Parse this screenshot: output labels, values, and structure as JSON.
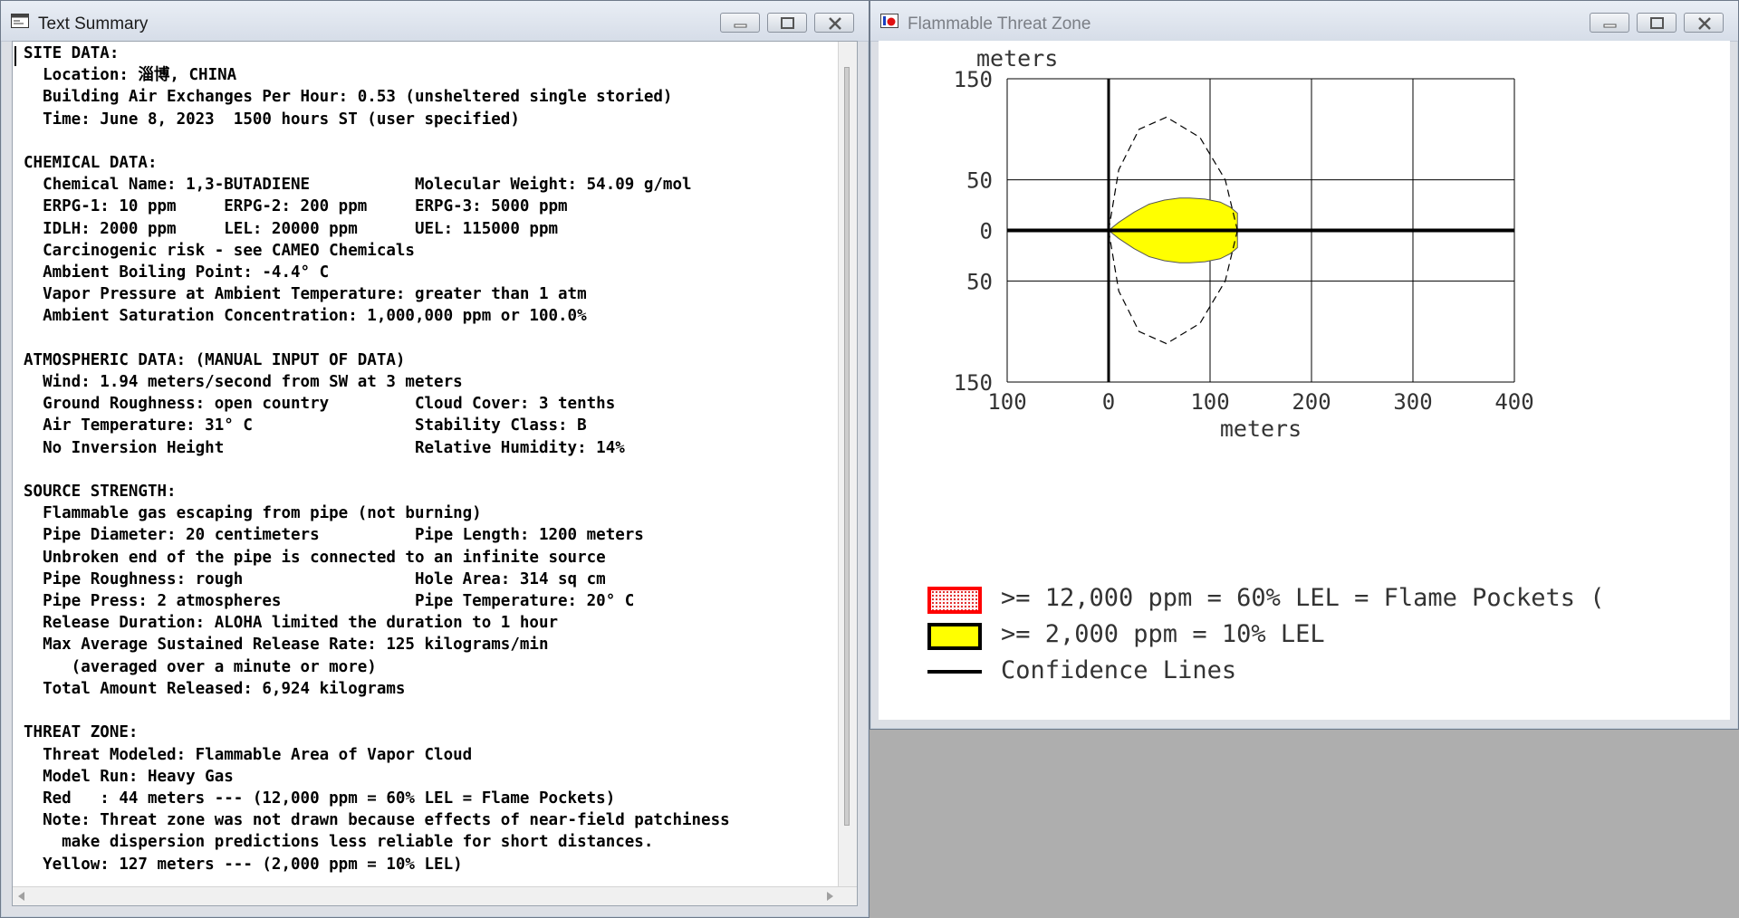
{
  "text_window": {
    "title": "Text Summary",
    "lines": [
      "SITE DATA:",
      "  Location: 淄博, CHINA",
      "  Building Air Exchanges Per Hour: 0.53 (unsheltered single storied)",
      "  Time: June 8, 2023  1500 hours ST (user specified)",
      "",
      "CHEMICAL DATA:",
      "  Chemical Name: 1,3-BUTADIENE           Molecular Weight: 54.09 g/mol",
      "  ERPG-1: 10 ppm     ERPG-2: 200 ppm     ERPG-3: 5000 ppm",
      "  IDLH: 2000 ppm     LEL: 20000 ppm      UEL: 115000 ppm",
      "  Carcinogenic risk - see CAMEO Chemicals",
      "  Ambient Boiling Point: -4.4° C",
      "  Vapor Pressure at Ambient Temperature: greater than 1 atm",
      "  Ambient Saturation Concentration: 1,000,000 ppm or 100.0%",
      "",
      "ATMOSPHERIC DATA: (MANUAL INPUT OF DATA)",
      "  Wind: 1.94 meters/second from SW at 3 meters",
      "  Ground Roughness: open country         Cloud Cover: 3 tenths",
      "  Air Temperature: 31° C                 Stability Class: B",
      "  No Inversion Height                    Relative Humidity: 14%",
      "",
      "SOURCE STRENGTH:",
      "  Flammable gas escaping from pipe (not burning)",
      "  Pipe Diameter: 20 centimeters          Pipe Length: 1200 meters",
      "  Unbroken end of the pipe is connected to an infinite source",
      "  Pipe Roughness: rough                  Hole Area: 314 sq cm",
      "  Pipe Press: 2 atmospheres              Pipe Temperature: 20° C",
      "  Release Duration: ALOHA limited the duration to 1 hour",
      "  Max Average Sustained Release Rate: 125 kilograms/min",
      "     (averaged over a minute or more)",
      "  Total Amount Released: 6,924 kilograms",
      "",
      "THREAT ZONE:",
      "  Threat Modeled: Flammable Area of Vapor Cloud",
      "  Model Run: Heavy Gas",
      "  Red   : 44 meters --- (12,000 ppm = 60% LEL = Flame Pockets)",
      "  Note: Threat zone was not drawn because effects of near-field patchiness",
      "    make dispersion predictions less reliable for short distances.",
      "  Yellow: 127 meters --- (2,000 ppm = 10% LEL)"
    ]
  },
  "plot_window": {
    "title": "Flammable Threat Zone",
    "legend": [
      {
        "label": ">= 12,000 ppm = 60% LEL = Flame Pockets (",
        "swatch": "red-dotted",
        "color": "#ff0000"
      },
      {
        "label": ">= 2,000 ppm = 10% LEL",
        "swatch": "yellow",
        "color": "#ffff00"
      },
      {
        "label": "Confidence Lines",
        "swatch": "black-line",
        "color": "#000000"
      }
    ]
  },
  "chart_data": {
    "type": "area",
    "xlabel": "meters",
    "ylabel": "meters",
    "x_ticks": [
      "100",
      "0",
      "100",
      "200",
      "300",
      "400"
    ],
    "y_ticks": [
      "150",
      "50",
      "0",
      "50",
      "150"
    ],
    "xlim": [
      -100,
      400
    ],
    "ylim": [
      -150,
      150
    ],
    "grid": true,
    "series": [
      {
        "name": ">= 2,000 ppm = 10% LEL",
        "kind": "filled-plume",
        "color": "#ffff00",
        "x": [
          0,
          10,
          25,
          40,
          55,
          70,
          80,
          95,
          110,
          120,
          127
        ],
        "y_upper": [
          0,
          8,
          18,
          26,
          30,
          32,
          32,
          31,
          28,
          23,
          17
        ],
        "y_lower": [
          0,
          -8,
          -18,
          -26,
          -30,
          -32,
          -32,
          -31,
          -28,
          -23,
          -17
        ]
      },
      {
        "name": "Confidence Lines",
        "kind": "dashed-ellipse",
        "color": "#000000",
        "x": [
          0,
          10,
          30,
          57,
          90,
          115,
          127
        ],
        "y_upper": [
          0,
          60,
          100,
          112,
          92,
          50,
          0
        ],
        "y_lower": [
          0,
          -60,
          -100,
          -112,
          -92,
          -50,
          0
        ]
      }
    ],
    "axes": {
      "x_axis_line": 0,
      "y_axis_line": 0
    }
  }
}
